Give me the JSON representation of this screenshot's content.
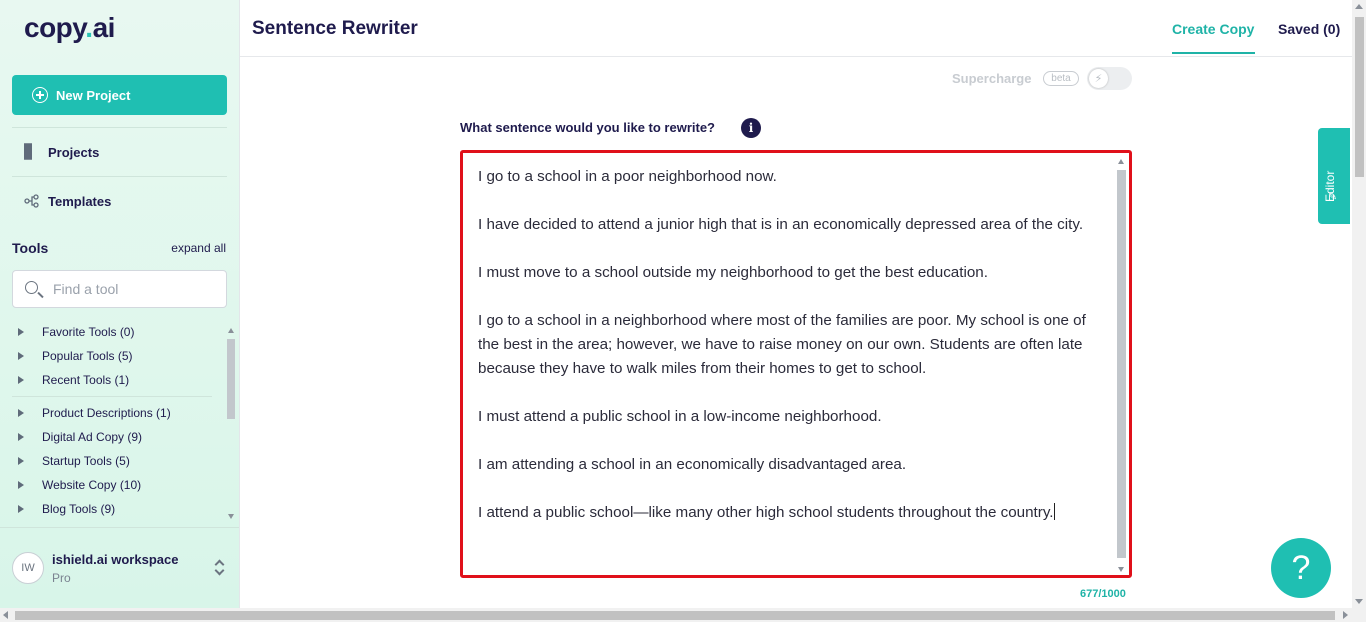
{
  "app": {
    "logo_text": "copy",
    "logo_dot": ".",
    "logo_suffix": "ai"
  },
  "sidebar": {
    "new_project_label": "New Project",
    "nav": [
      {
        "label": "Projects",
        "icon": "grid-icon"
      },
      {
        "label": "Templates",
        "icon": "templates-icon"
      }
    ],
    "tools_heading": "Tools",
    "expand_all_label": "expand all",
    "search_placeholder": "Find a tool",
    "tool_groups": [
      "Favorite Tools (0)",
      "Popular Tools (5)",
      "Recent Tools (1)",
      "Product Descriptions (1)",
      "Digital Ad Copy (9)",
      "Startup Tools (5)",
      "Website Copy (10)",
      "Blog Tools (9)"
    ],
    "workspace": {
      "initials": "IW",
      "name": "ishield.ai workspace",
      "plan": "Pro"
    }
  },
  "header": {
    "title": "Sentence Rewriter",
    "tabs": {
      "create": "Create Copy",
      "saved": "Saved (0)"
    }
  },
  "main": {
    "supercharge_label": "Supercharge",
    "beta_label": "beta",
    "question": "What sentence would you like to rewrite?",
    "info_symbol": "i",
    "input_text": "I go to a school in a poor neighborhood now.\n\nI have decided to attend a junior high that is in an economically depressed area of the city.\n\nI must move to a school outside my neighborhood to get the best education.\n\nI go to a school in a neighborhood where most of the families are poor. My school is one of the best in the area; however, we have to raise money on our own. Students are often late because they have to walk miles from their homes to get to school.\n\nI must attend a public school in a low-income neighborhood.\n\nI am attending a school in an economically disadvantaged area.\n\nI attend a public school—like many other high school students throughout the country.",
    "char_count": "677/1000"
  },
  "editor_tab_label": "Editor",
  "help_symbol": "?",
  "colors": {
    "accent": "#1fbfb2",
    "brand_dark": "#1f1b4d",
    "highlight_border": "#e0101a"
  }
}
